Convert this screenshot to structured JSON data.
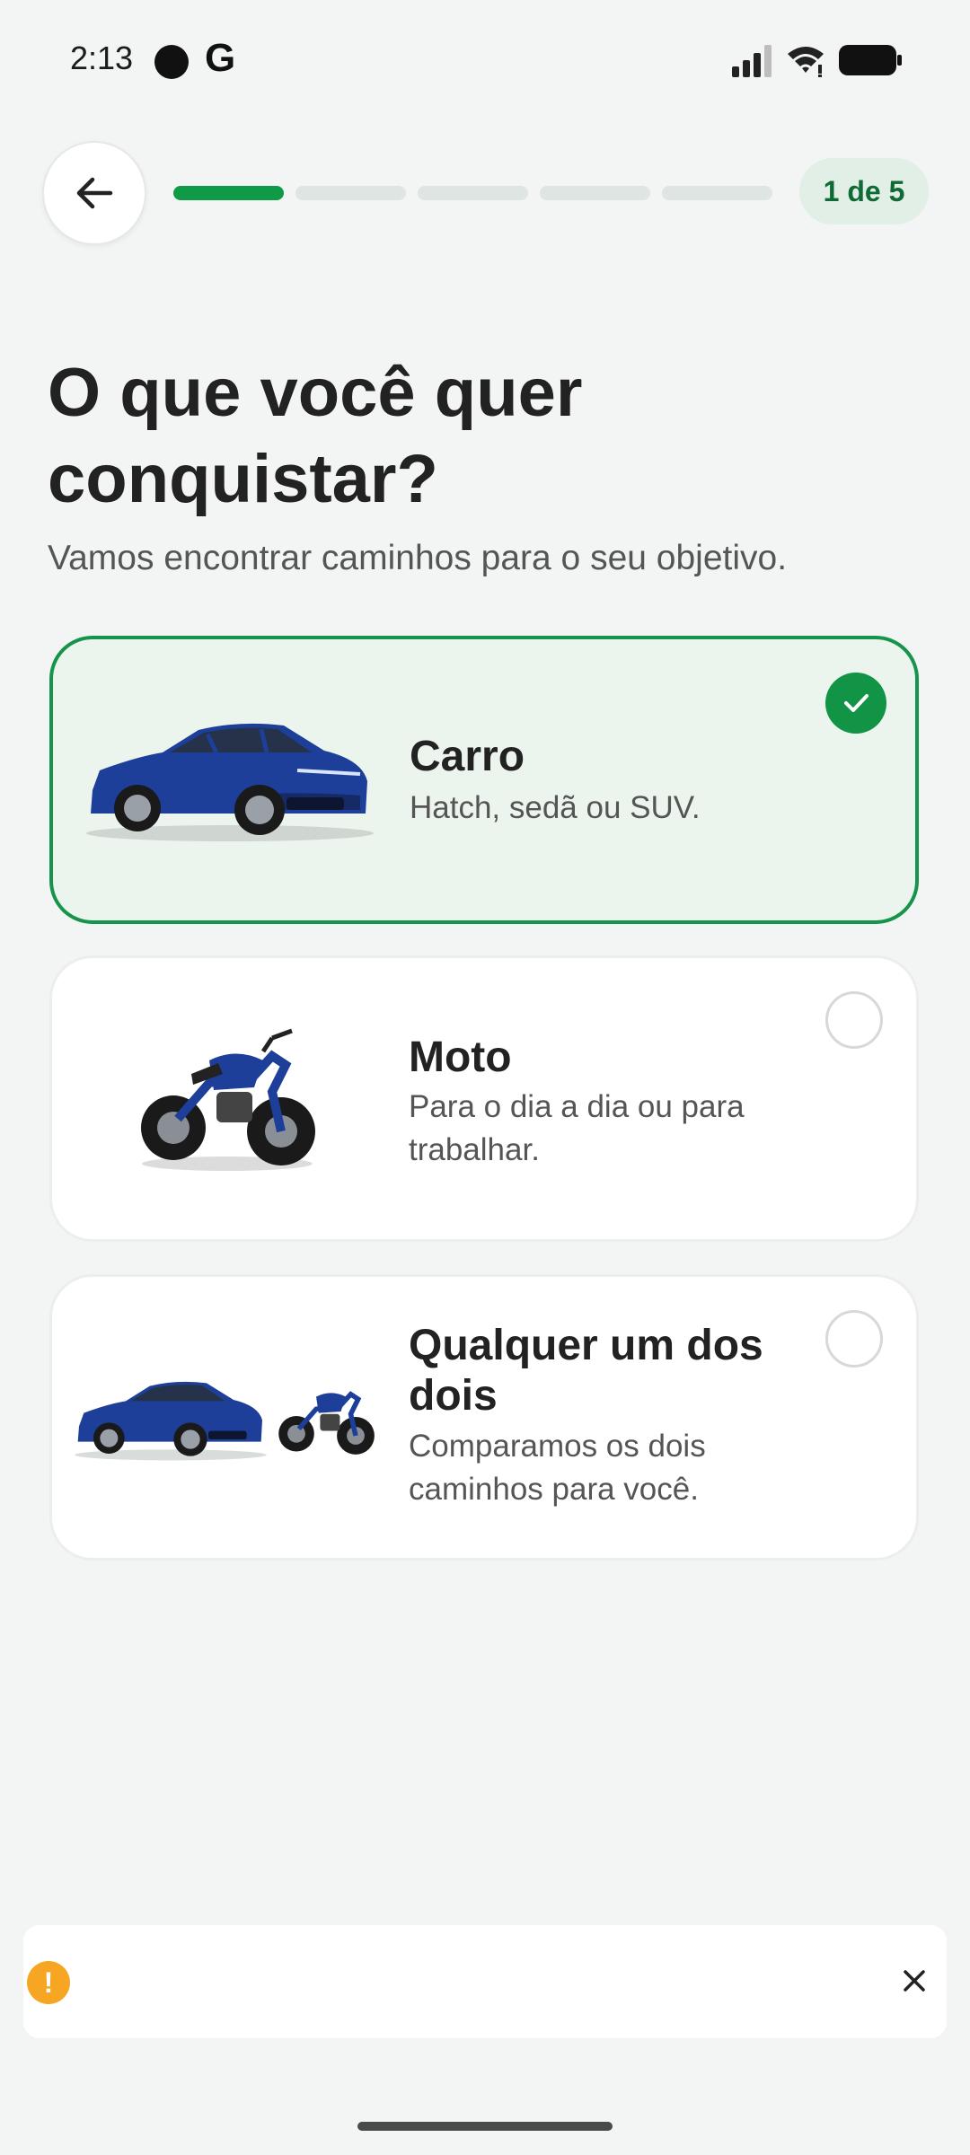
{
  "status_bar": {
    "time": "2:13",
    "g_glyph": "G"
  },
  "header": {
    "back_icon": "arrow-left-icon",
    "progress": {
      "current": 1,
      "total": 5
    },
    "step_label": "1 de 5"
  },
  "main": {
    "title": "O que você quer conquistar?",
    "subtitle": "Vamos encontrar caminhos para o seu objetivo.",
    "options": [
      {
        "title": "Carro",
        "description": "Hatch, sedã ou SUV.",
        "selected": true
      },
      {
        "title": "Moto",
        "description": "Para o dia a dia ou para trabalhar.",
        "selected": false
      },
      {
        "title": "Qualquer um dos dois",
        "description": "Comparamos os dois caminhos para você.",
        "selected": false
      }
    ]
  },
  "colors": {
    "accent": "#0f9a48",
    "selected_bg": "#ebf5ee",
    "vehicle_blue": "#1d3f9a",
    "warning": "#f6a623"
  }
}
